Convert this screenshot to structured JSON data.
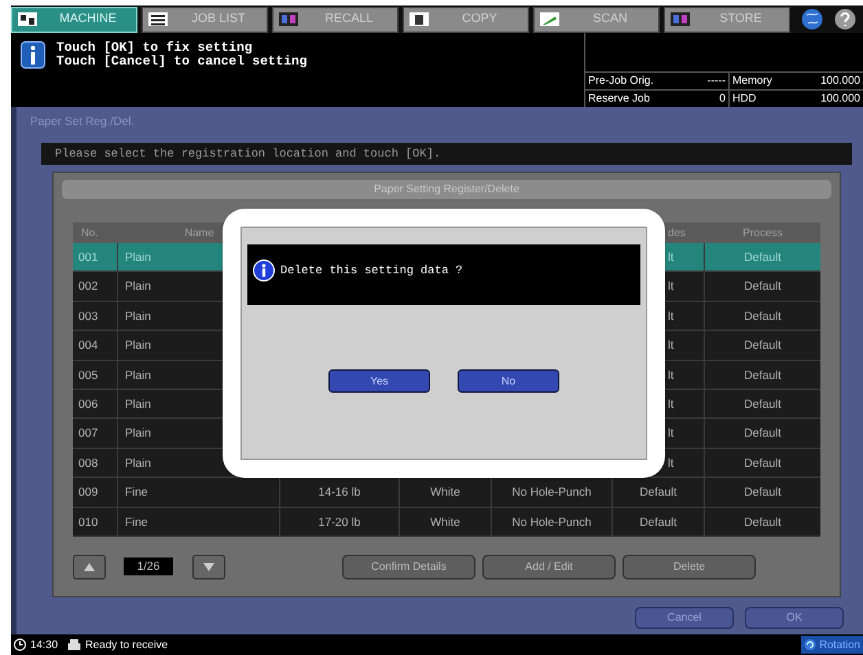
{
  "tabs": [
    {
      "label": "MACHINE",
      "selected": true
    },
    {
      "label": "JOB LIST",
      "selected": false
    },
    {
      "label": "RECALL",
      "selected": false
    },
    {
      "label": "COPY",
      "selected": false
    },
    {
      "label": "SCAN",
      "selected": false
    },
    {
      "label": "STORE",
      "selected": false
    }
  ],
  "message": {
    "lines": [
      "Touch [OK] to fix setting",
      "Touch [Cancel] to cancel setting"
    ]
  },
  "job_status": [
    {
      "label": "Pre-Job Orig.",
      "value": "-----",
      "label_2": "Memory",
      "value_2": "100.000"
    },
    {
      "label": "Reserve Job",
      "value": "0",
      "label_2": "HDD",
      "value_2": "100.000"
    }
  ],
  "screen_title": "Paper Set Reg./Del.",
  "instruction": "Please select the registration location and touch [OK].",
  "panel_title": "Paper Setting Register/Delete",
  "table": {
    "columns": {
      "no": "No.",
      "name": "Name",
      "column_6": "des",
      "process": "Process"
    },
    "rows": [
      {
        "selected": true,
        "no": "001",
        "name": "Plain",
        "column_6": "lt",
        "process": "Default"
      },
      {
        "selected": false,
        "no": "002",
        "name": "Plain",
        "column_6": "lt",
        "process": "Default"
      },
      {
        "selected": false,
        "no": "003",
        "name": "Plain",
        "column_6": "lt",
        "process": "Default"
      },
      {
        "selected": false,
        "no": "004",
        "name": "Plain",
        "column_6": "lt",
        "process": "Default"
      },
      {
        "selected": false,
        "no": "005",
        "name": "Plain",
        "column_6": "lt",
        "process": "Default"
      },
      {
        "selected": false,
        "no": "006",
        "name": "Plain",
        "column_6": "lt",
        "process": "Default"
      },
      {
        "selected": false,
        "no": "007",
        "name": "Plain",
        "column_6": "lt",
        "process": "Default"
      },
      {
        "selected": false,
        "no": "008",
        "name": "Plain",
        "column_6": "lt",
        "process": "Default"
      },
      {
        "selected": false,
        "no": "009",
        "name": "Fine",
        "column_3": "14-16 lb",
        "column_4": "White",
        "column_5": "No Hole-Punch",
        "column_6": "Default",
        "process": "Default"
      },
      {
        "selected": false,
        "no": "010",
        "name": "Fine",
        "column_3": "17-20 lb",
        "column_4": "White",
        "column_5": "No Hole-Punch",
        "column_6": "Default",
        "process": "Default"
      }
    ]
  },
  "page": "1/26",
  "actions": [
    "Confirm Details",
    "Add / Edit",
    "Delete"
  ],
  "footer_buttons": [
    "Cancel",
    "OK"
  ],
  "dialog": {
    "message": "Delete this setting data ?",
    "buttons": [
      "Yes",
      "No"
    ]
  },
  "status_bar": {
    "time": "14:30",
    "status": "Ready to receive",
    "rotation": "Rotation"
  }
}
